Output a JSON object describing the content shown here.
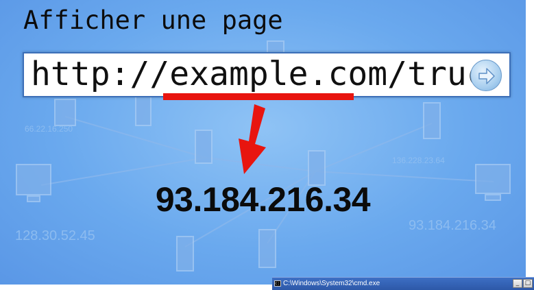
{
  "title": "Afficher une page",
  "address_bar": {
    "url": "http://example.com/truc",
    "go_icon": "arrow-right-circle-icon"
  },
  "resolved_ip": "93.184.216.34",
  "background_labels": [
    "66.22.16.250",
    "128.30.52.45",
    "93.184.216.34",
    "136.228.23.64"
  ],
  "cmd_window": {
    "title": "C:\\Windows\\System32\\cmd.exe",
    "icon": "console-icon",
    "minimize_label": "_",
    "maximize_label": "□"
  },
  "colors": {
    "accent_red": "#e8150f",
    "background_blue": "#6aa9ee",
    "taskbar_blue": "#2d58a8"
  }
}
